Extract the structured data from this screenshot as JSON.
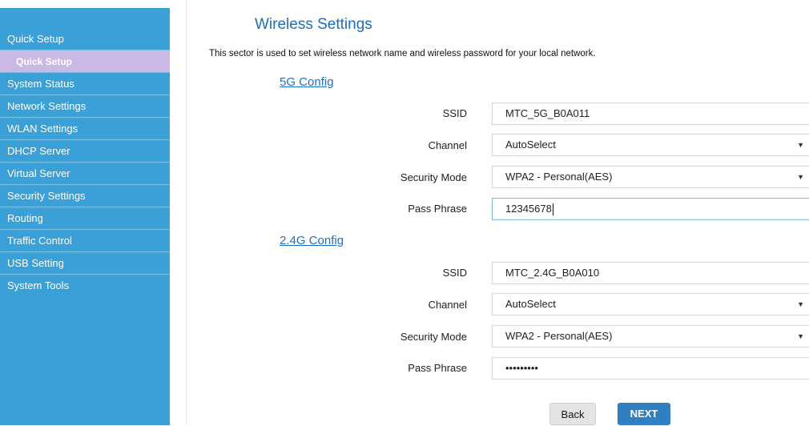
{
  "sidebar": {
    "items": [
      {
        "label": "Quick Setup",
        "sub": false
      },
      {
        "label": "Quick Setup",
        "sub": true
      },
      {
        "label": "System Status",
        "sub": false
      },
      {
        "label": "Network Settings",
        "sub": false
      },
      {
        "label": "WLAN Settings",
        "sub": false
      },
      {
        "label": "DHCP Server",
        "sub": false
      },
      {
        "label": "Virtual Server",
        "sub": false
      },
      {
        "label": "Security Settings",
        "sub": false
      },
      {
        "label": "Routing",
        "sub": false
      },
      {
        "label": "Traffic Control",
        "sub": false
      },
      {
        "label": "USB Setting",
        "sub": false
      },
      {
        "label": "System Tools",
        "sub": false
      }
    ]
  },
  "page": {
    "title": "Wireless Settings",
    "description": "This sector is used to set wireless network name and wireless password for your local network."
  },
  "config5g": {
    "heading": "5G Config",
    "ssid_label": "SSID",
    "ssid_value": "MTC_5G_B0A011",
    "channel_label": "Channel",
    "channel_value": "AutoSelect",
    "security_label": "Security Mode",
    "security_value": "WPA2 - Personal(AES)",
    "pass_label": "Pass Phrase",
    "pass_value": "12345678"
  },
  "config24g": {
    "heading": "2.4G Config",
    "ssid_label": "SSID",
    "ssid_value": "MTC_2.4G_B0A010",
    "channel_label": "Channel",
    "channel_value": "AutoSelect",
    "security_label": "Security Mode",
    "security_value": "WPA2 - Personal(AES)",
    "pass_label": "Pass Phrase",
    "pass_value": "•••••••••"
  },
  "buttons": {
    "back": "Back",
    "next": "NEXT"
  },
  "icons": {
    "dropdown": "▼"
  },
  "colors": {
    "sidebar_bg": "#3aa0d8",
    "sidebar_selected": "#c9b9e4",
    "title": "#1e6eb6",
    "link": "#1f6fc0",
    "next_button": "#2f7fc1"
  }
}
